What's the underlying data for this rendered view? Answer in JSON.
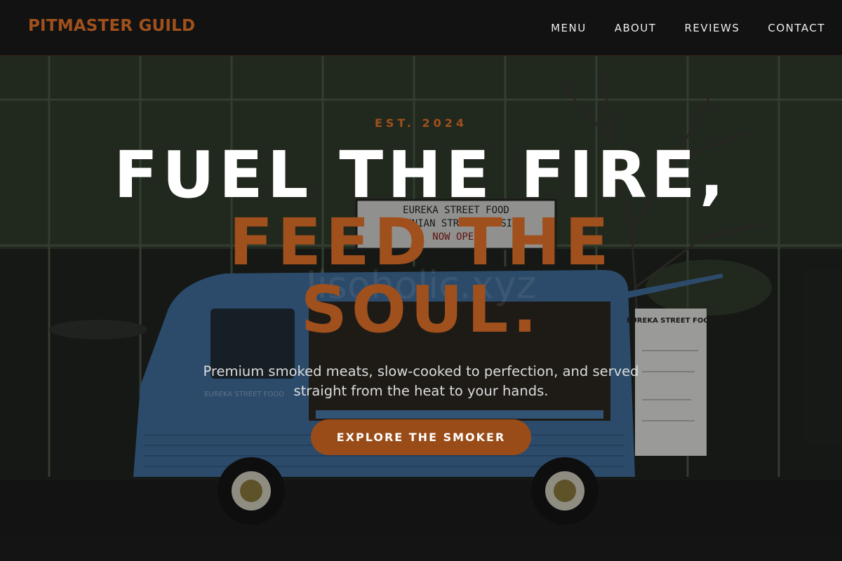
{
  "brand": {
    "name": "PITMASTER GUILD",
    "accent": "#a0501c"
  },
  "nav": {
    "links": [
      {
        "label": "MENU"
      },
      {
        "label": "ABOUT"
      },
      {
        "label": "REVIEWS"
      },
      {
        "label": "CONTACT"
      }
    ]
  },
  "hero": {
    "eyebrow": "EST. 2024",
    "headline_line1": "FUEL THE FIRE,",
    "headline_line2": "FEED THE SOUL.",
    "subtext": "Premium smoked meats, slow-cooked to perfection, and served straight from the heat to your hands.",
    "cta_label": "EXPLORE THE SMOKER",
    "image": {
      "sign_line1": "EUREKA STREET FOOD",
      "sign_line2": "ARMENIAN STREET CUISINE",
      "sign_line3": "NOW OPEN",
      "menu_board": "EUREKA STREET FOOD",
      "truck_text": "EUREKA STREET FOOD",
      "watermark": "Iisoholic.xyz"
    }
  }
}
